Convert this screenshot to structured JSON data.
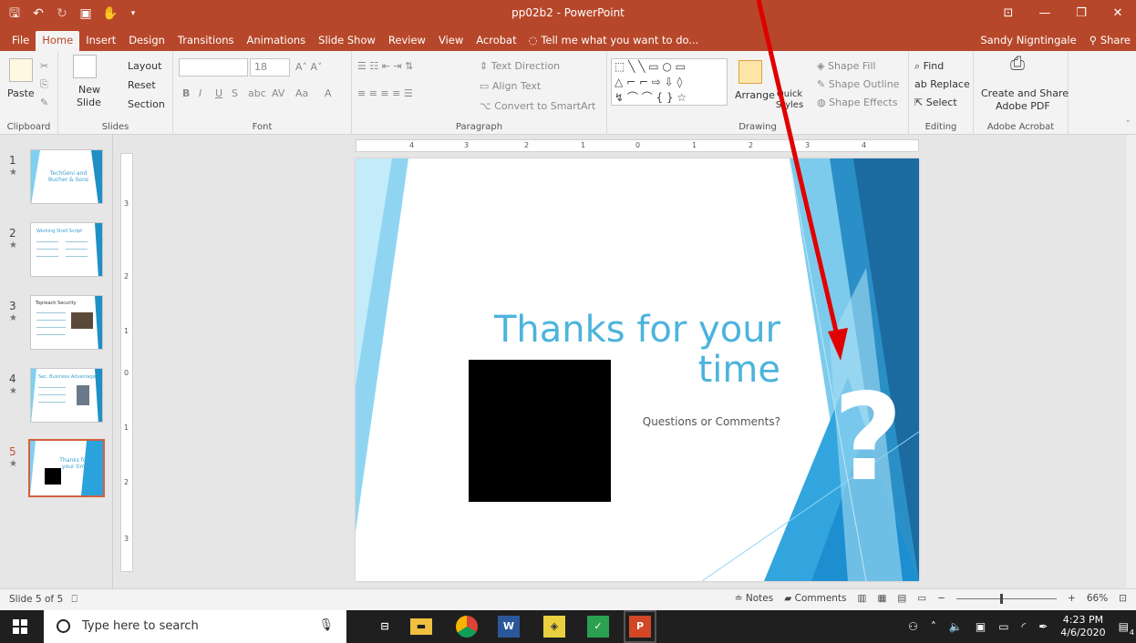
{
  "window": {
    "title": "pp02b2 - PowerPoint",
    "user": "Sandy Nigntingale",
    "share": "Share"
  },
  "colors": {
    "accent": "#b7472a",
    "slide_title": "#4cb4dc",
    "arrow": "#e00000"
  },
  "tabs": [
    "File",
    "Home",
    "Insert",
    "Design",
    "Transitions",
    "Animations",
    "Slide Show",
    "Review",
    "View",
    "Acrobat"
  ],
  "tellme": "Tell me what you want to do...",
  "ribbon": {
    "clipboard": {
      "label": "Clipboard",
      "paste": "Paste"
    },
    "slides": {
      "label": "Slides",
      "new_slide": "New",
      "new_slide2": "Slide",
      "layout": "Layout",
      "reset": "Reset",
      "section": "Section"
    },
    "font": {
      "label": "Font",
      "size": "18"
    },
    "paragraph": {
      "label": "Paragraph",
      "text_direction": "Text Direction",
      "align_text": "Align Text",
      "convert": "Convert to SmartArt"
    },
    "drawing": {
      "label": "Drawing",
      "arrange": "Arrange",
      "quick_styles": "Quick Styles",
      "shape_fill": "Shape Fill",
      "shape_outline": "Shape Outline",
      "shape_effects": "Shape Effects"
    },
    "editing": {
      "label": "Editing",
      "find": "Find",
      "replace": "Replace",
      "select": "Select"
    },
    "acrobat": {
      "label": "Adobe Acrobat",
      "create_share": "Create and Share",
      "adobe_pdf": "Adobe PDF"
    }
  },
  "thumbnails": [
    {
      "num": "1",
      "text": "TechGeni and Bucher & Sons"
    },
    {
      "num": "2",
      "text": "Working Shell Script"
    },
    {
      "num": "3",
      "text": "Topreach Security"
    },
    {
      "num": "4",
      "text": "Sec. Business Advantage"
    },
    {
      "num": "5",
      "text": "Thanks for your time"
    }
  ],
  "slide": {
    "title_line1": "Thanks for your",
    "title_line2": "time",
    "subtitle": "Questions or Comments?"
  },
  "statusbar": {
    "slide_of": "Slide 5 of 5",
    "notes": "Notes",
    "comments": "Comments",
    "zoom": "66%"
  },
  "taskbar": {
    "search_placeholder": "Type here to search",
    "time": "4:23 PM",
    "date": "4/6/2020",
    "notif_count": "4"
  }
}
